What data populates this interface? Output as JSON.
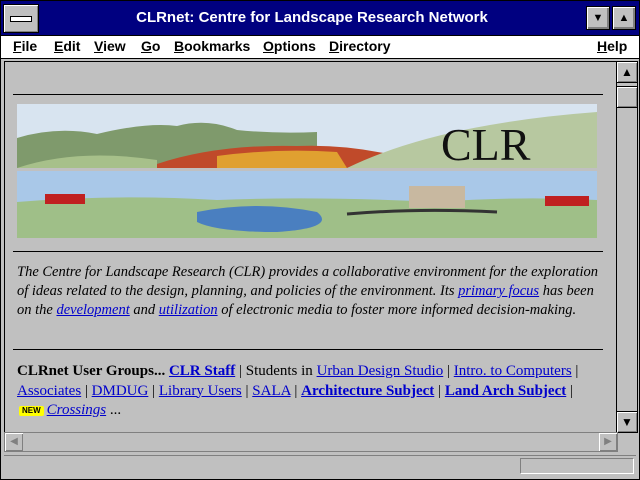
{
  "window": {
    "title": "CLRnet: Centre for Landscape Research Network"
  },
  "menu": {
    "items": [
      "File",
      "Edit",
      "View",
      "Go",
      "Bookmarks",
      "Options",
      "Directory"
    ],
    "help": "Help"
  },
  "banner": {
    "logo_text": "CLR"
  },
  "intro": {
    "text_1": "The Centre for Landscape Research (CLR) provides a collaborative environment for the exploration of ideas related to the design, planning, and policies of the environment. Its ",
    "link_primary_focus": "primary focus",
    "text_2": " has been on the ",
    "link_development": "development",
    "text_3": " and ",
    "link_utilization": "utilization",
    "text_4": " of electronic media to foster more informed decision-making."
  },
  "groups": {
    "lead": "CLRnet User Groups...",
    "clr_staff": "CLR Staff",
    "sep_students": " | Students in ",
    "urban_design": "Urban Design Studio",
    "intro_computers": "Intro. to Computers",
    "associates": "Associates",
    "dmdug": "DMDUG",
    "library_users": "Library Users",
    "sala": "SALA",
    "architecture": "Architecture Subject",
    "land_arch": "Land Arch Subject",
    "new_badge": "NEW",
    "crossings": "Crossings",
    "ellipsis": " ..."
  },
  "scrollbar": {
    "up_icon": "arrow-up-icon",
    "down_icon": "arrow-down-icon",
    "left_icon": "arrow-left-icon",
    "right_icon": "arrow-right-icon"
  },
  "colors": {
    "titlebar": "#000080",
    "link": "#0000cc",
    "chrome": "#c0c0c0"
  }
}
